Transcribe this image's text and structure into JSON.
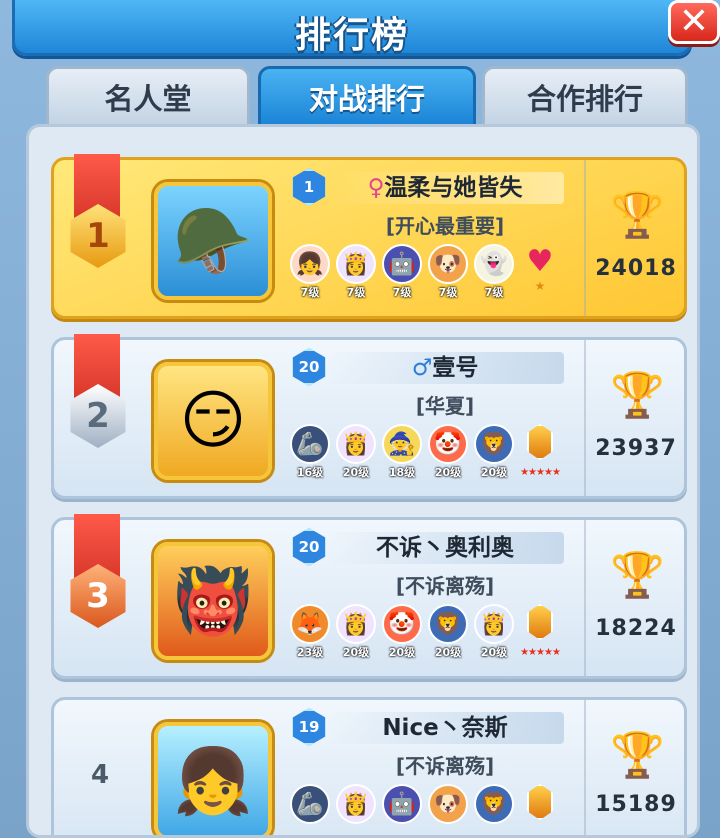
{
  "header": {
    "title": "排行榜",
    "close_label": "✕"
  },
  "tabs": [
    {
      "label": "名人堂",
      "active": false
    },
    {
      "label": "对战排行",
      "active": true
    },
    {
      "label": "合作排行",
      "active": false
    }
  ],
  "rows": [
    {
      "rank": "1",
      "level": "1",
      "gender_symbol": "♀",
      "name": "温柔与她皆失",
      "guild": "[开心最重要]",
      "avatar_icon": "🪖",
      "score": "24018",
      "pets": [
        {
          "icon": "👧",
          "level": "7级"
        },
        {
          "icon": "👸",
          "level": "7级"
        },
        {
          "icon": "🤖",
          "level": "7级"
        },
        {
          "icon": "🐶",
          "level": "7级"
        },
        {
          "icon": "👻",
          "level": "7级"
        }
      ],
      "extra_icon": "♥",
      "extra_stars": "★"
    },
    {
      "rank": "2",
      "level": "20",
      "gender_symbol": "♂",
      "name": "壹号",
      "guild": "[华夏]",
      "avatar_icon": "😏",
      "score": "23937",
      "pets": [
        {
          "icon": "🦾",
          "level": "16级"
        },
        {
          "icon": "👸",
          "level": "20级"
        },
        {
          "icon": "🧙",
          "level": "18级"
        },
        {
          "icon": "🤡",
          "level": "20级"
        },
        {
          "icon": "🦁",
          "level": "20级"
        }
      ],
      "extra_stars": "★★★★★"
    },
    {
      "rank": "3",
      "level": "20",
      "gender_symbol": "",
      "name": "不诉丶奥利奥",
      "guild": "[不诉离殇]",
      "avatar_icon": "👹",
      "score": "18224",
      "pets": [
        {
          "icon": "🦊",
          "level": "23级"
        },
        {
          "icon": "👸",
          "level": "20级"
        },
        {
          "icon": "🤡",
          "level": "20级"
        },
        {
          "icon": "🦁",
          "level": "20级"
        },
        {
          "icon": "👸",
          "level": "20级"
        }
      ],
      "extra_stars": "★★★★★"
    },
    {
      "rank": "4",
      "level": "19",
      "gender_symbol": "",
      "name": "Nice丶奈斯",
      "guild": "[不诉离殇]",
      "avatar_icon": "👧",
      "score": "15189",
      "pets": [
        {
          "icon": "🦾",
          "level": ""
        },
        {
          "icon": "👸",
          "level": ""
        },
        {
          "icon": "🤖",
          "level": ""
        },
        {
          "icon": "🐶",
          "level": ""
        },
        {
          "icon": "🦁",
          "level": ""
        }
      ],
      "extra_stars": ""
    }
  ]
}
